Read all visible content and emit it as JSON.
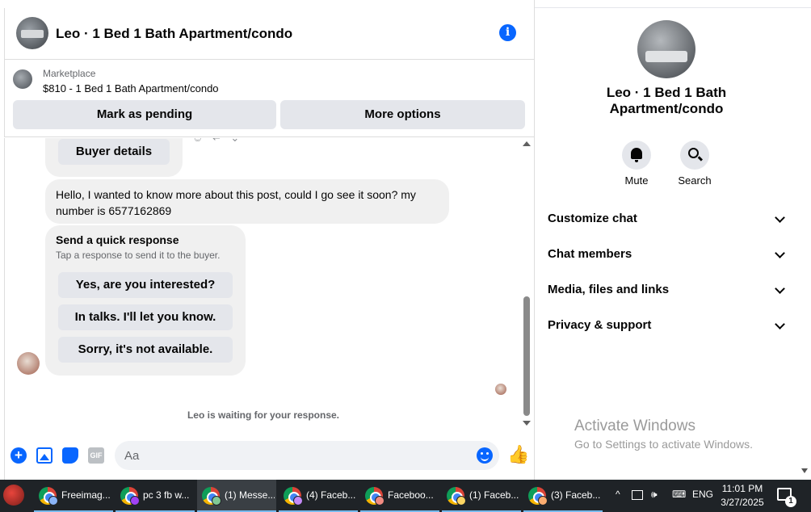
{
  "chat": {
    "title": "Leo · 1 Bed 1 Bath Apartment/condo",
    "marketplace_label": "Marketplace",
    "listing_line": "$810 - 1 Bed 1 Bath Apartment/condo",
    "mark_pending_label": "Mark as pending",
    "more_options_label": "More options"
  },
  "messages": {
    "reaction_glyphs": "☺ ↩ ⌄",
    "buyer_details_label": "Buyer details",
    "incoming_text": "Hello, I wanted to know more about this post, could I go see it soon? my number is 6577162869",
    "quick_title": "Send a quick response",
    "quick_subtitle": "Tap a response to send it to the buyer.",
    "quick_replies": [
      "Yes, are you interested?",
      "In talks. I'll let you know.",
      "Sorry, it's not available."
    ],
    "waiting_text": "Leo is waiting for your response."
  },
  "composer": {
    "placeholder": "Aa",
    "gif_label": "GIF",
    "plus_label": "+",
    "like_glyph": "👍"
  },
  "sidebar": {
    "name": "Leo · 1 Bed 1 Bath Apartment/condo",
    "mute_label": "Mute",
    "search_label": "Search",
    "sections": [
      "Customize chat",
      "Chat members",
      "Media, files and links",
      "Privacy & support"
    ]
  },
  "watermark": {
    "line1": "Activate Windows",
    "line2": "Go to Settings to activate Windows."
  },
  "taskbar": {
    "tasks": [
      "Freeimag...",
      "pc 3 fb w...",
      "(1) Messe...",
      "(4) Faceb...",
      "Faceboo...",
      "(1) Faceb...",
      "(3) Faceb..."
    ],
    "tray_chevron": "^",
    "volume_glyph": "🕪",
    "keyboard_glyph": "⌨",
    "language": "ENG",
    "time": "11:01 PM",
    "date": "3/27/2025",
    "notification_count": "1"
  },
  "colors": {
    "accent": "#0866ff",
    "bubble": "#f0f0f0",
    "button_grey": "#e4e6eb",
    "taskbar": "#1f2327"
  }
}
